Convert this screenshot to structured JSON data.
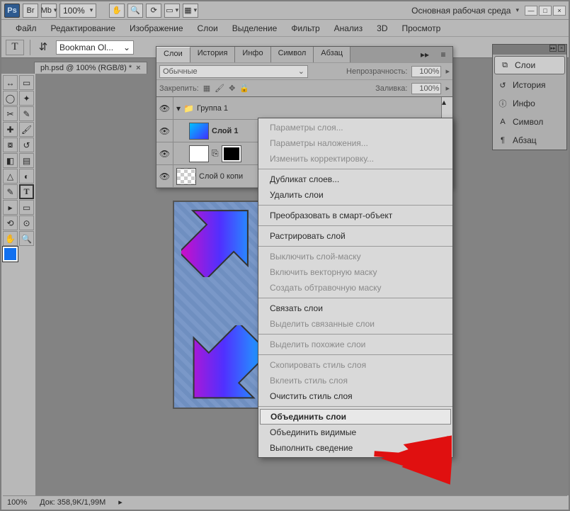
{
  "topbar": {
    "ps": "Ps",
    "br": "Br",
    "mb": "Mb",
    "zoom": "100%",
    "workspace": "Основная рабочая среда"
  },
  "menubar": [
    "Файл",
    "Редактирование",
    "Изображение",
    "Слои",
    "Выделение",
    "Фильтр",
    "Анализ",
    "3D",
    "Просмотр"
  ],
  "optbar": {
    "t": "T",
    "font": "Bookman Ol..."
  },
  "doctab": {
    "title": "ph.psd @ 100% (RGB/8) *",
    "close": "×"
  },
  "layerspanel": {
    "tabs": [
      "Слои",
      "История",
      "Инфо",
      "Символ",
      "Абзац"
    ],
    "blend": "Обычные",
    "opacity_label": "Непрозрачность:",
    "opacity_val": "100%",
    "lock_label": "Закрепить:",
    "fill_label": "Заливка:",
    "fill_val": "100%",
    "rows": [
      {
        "name": "Группа 1"
      },
      {
        "name": "Слой 1"
      },
      {
        "name": ""
      },
      {
        "name": "Слой 0 копи"
      }
    ]
  },
  "ctxmenu": [
    {
      "t": "Параметры слоя...",
      "d": true
    },
    {
      "t": "Параметры наложения...",
      "d": true
    },
    {
      "t": "Изменить корректировку...",
      "d": true
    },
    {
      "sep": true
    },
    {
      "t": "Дубликат слоев..."
    },
    {
      "t": "Удалить слои"
    },
    {
      "sep": true
    },
    {
      "t": "Преобразовать в смарт-объект"
    },
    {
      "sep": true
    },
    {
      "t": "Растрировать слой"
    },
    {
      "sep": true
    },
    {
      "t": "Выключить слой-маску",
      "d": true
    },
    {
      "t": "Включить векторную маску",
      "d": true
    },
    {
      "t": "Создать обтравочную маску",
      "d": true
    },
    {
      "sep": true
    },
    {
      "t": "Связать слои"
    },
    {
      "t": "Выделить связанные слои",
      "d": true
    },
    {
      "sep": true
    },
    {
      "t": "Выделить похожие слои",
      "d": true
    },
    {
      "sep": true
    },
    {
      "t": "Скопировать стиль слоя",
      "d": true
    },
    {
      "t": "Вклеить стиль слоя",
      "d": true
    },
    {
      "t": "Очистить стиль слоя"
    },
    {
      "sep": true
    },
    {
      "t": "Объединить слои",
      "hl": true
    },
    {
      "t": "Объединить видимые"
    },
    {
      "t": "Выполнить сведение"
    }
  ],
  "rightflyout": [
    {
      "icon": "⧉",
      "label": "Слои",
      "active": true
    },
    {
      "icon": "↺",
      "label": "История"
    },
    {
      "icon": "ⓘ",
      "label": "Инфо"
    },
    {
      "icon": "A",
      "label": "Символ"
    },
    {
      "icon": "¶",
      "label": "Абзац"
    }
  ],
  "statusbar": {
    "zoom": "100%",
    "doc": "Док: 358,9K/1,99M"
  }
}
